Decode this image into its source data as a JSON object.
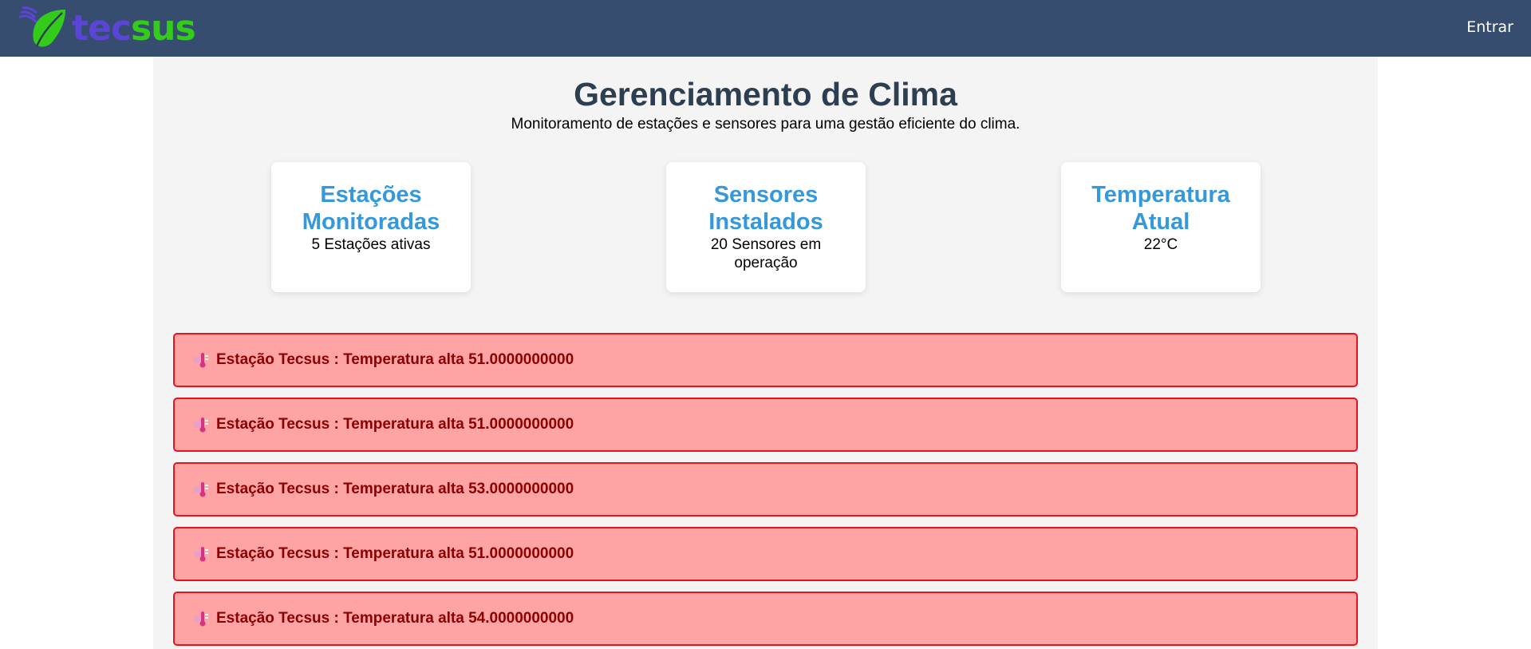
{
  "brand": {
    "logo_part1": "tec",
    "logo_part2": "sus",
    "colors": {
      "navbar": "#374d6f",
      "tec": "#5a45d6",
      "sus": "#33cc1a",
      "leaf": "#33cc1a"
    }
  },
  "nav": {
    "login_label": "Entrar"
  },
  "header": {
    "title": "Gerenciamento de Clima",
    "subtitle": "Monitoramento de estações e sensores para uma gestão eficiente do clima."
  },
  "cards": [
    {
      "title": "Estações Monitoradas",
      "text": "5 Estações ativas"
    },
    {
      "title": "Sensores Instalados",
      "text": "20 Sensores em operação"
    },
    {
      "title": "Temperatura Atual",
      "text": "22°C"
    }
  ],
  "alerts": [
    {
      "icon": "thermometer-icon",
      "text": "Estação Tecsus : Temperatura alta 51.0000000000"
    },
    {
      "icon": "thermometer-icon",
      "text": "Estação Tecsus : Temperatura alta 51.0000000000"
    },
    {
      "icon": "thermometer-icon",
      "text": "Estação Tecsus : Temperatura alta 53.0000000000"
    },
    {
      "icon": "thermometer-icon",
      "text": "Estação Tecsus : Temperatura alta 51.0000000000"
    },
    {
      "icon": "thermometer-icon",
      "text": "Estação Tecsus : Temperatura alta 54.0000000000"
    }
  ]
}
